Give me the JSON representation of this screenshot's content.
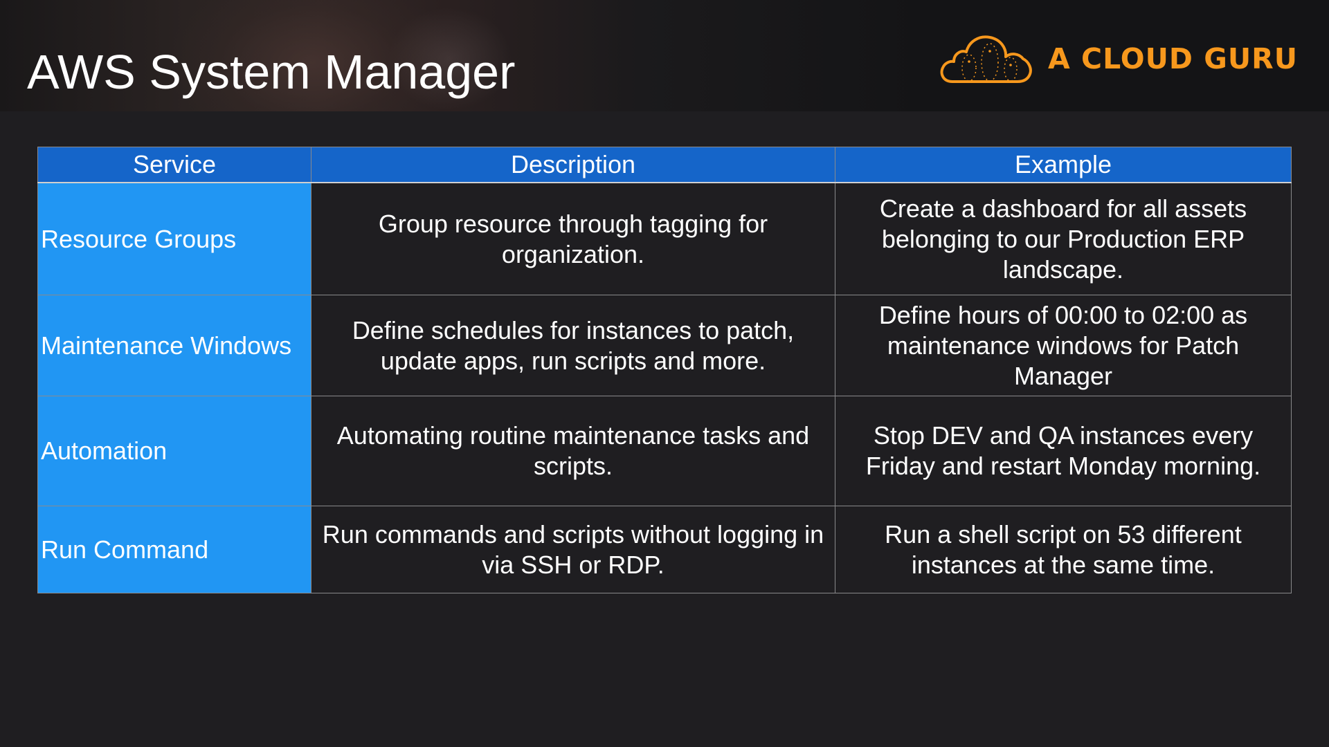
{
  "slide": {
    "title": "AWS System Manager"
  },
  "logo": {
    "text": "A CLOUD GURU",
    "icon": "cloud-logo-icon",
    "color": "#f7981d"
  },
  "table": {
    "headers": [
      "Service",
      "Description",
      "Example"
    ],
    "rows": [
      {
        "service": "Resource Groups",
        "description": "Group resource through tagging for organization.",
        "example": "Create a dashboard for all assets belonging to our Production ERP landscape."
      },
      {
        "service": "Maintenance Windows",
        "description": "Define schedules for instances to patch, update apps, run scripts and more.",
        "example": "Define hours of 00:00 to 02:00 as maintenance windows for Patch Manager"
      },
      {
        "service": "Automation",
        "description": "Automating routine maintenance tasks and scripts.",
        "example": "Stop DEV and QA instances every Friday and restart Monday morning."
      },
      {
        "service": "Run Command",
        "description": "Run commands and scripts without logging in via SSH or RDP.",
        "example": "Run a shell script on 53 different instances at the same time."
      }
    ]
  },
  "colors": {
    "background": "#1f1e21",
    "header_row": "#1565c9",
    "service_column": "#2196f3",
    "text": "#ffffff"
  }
}
